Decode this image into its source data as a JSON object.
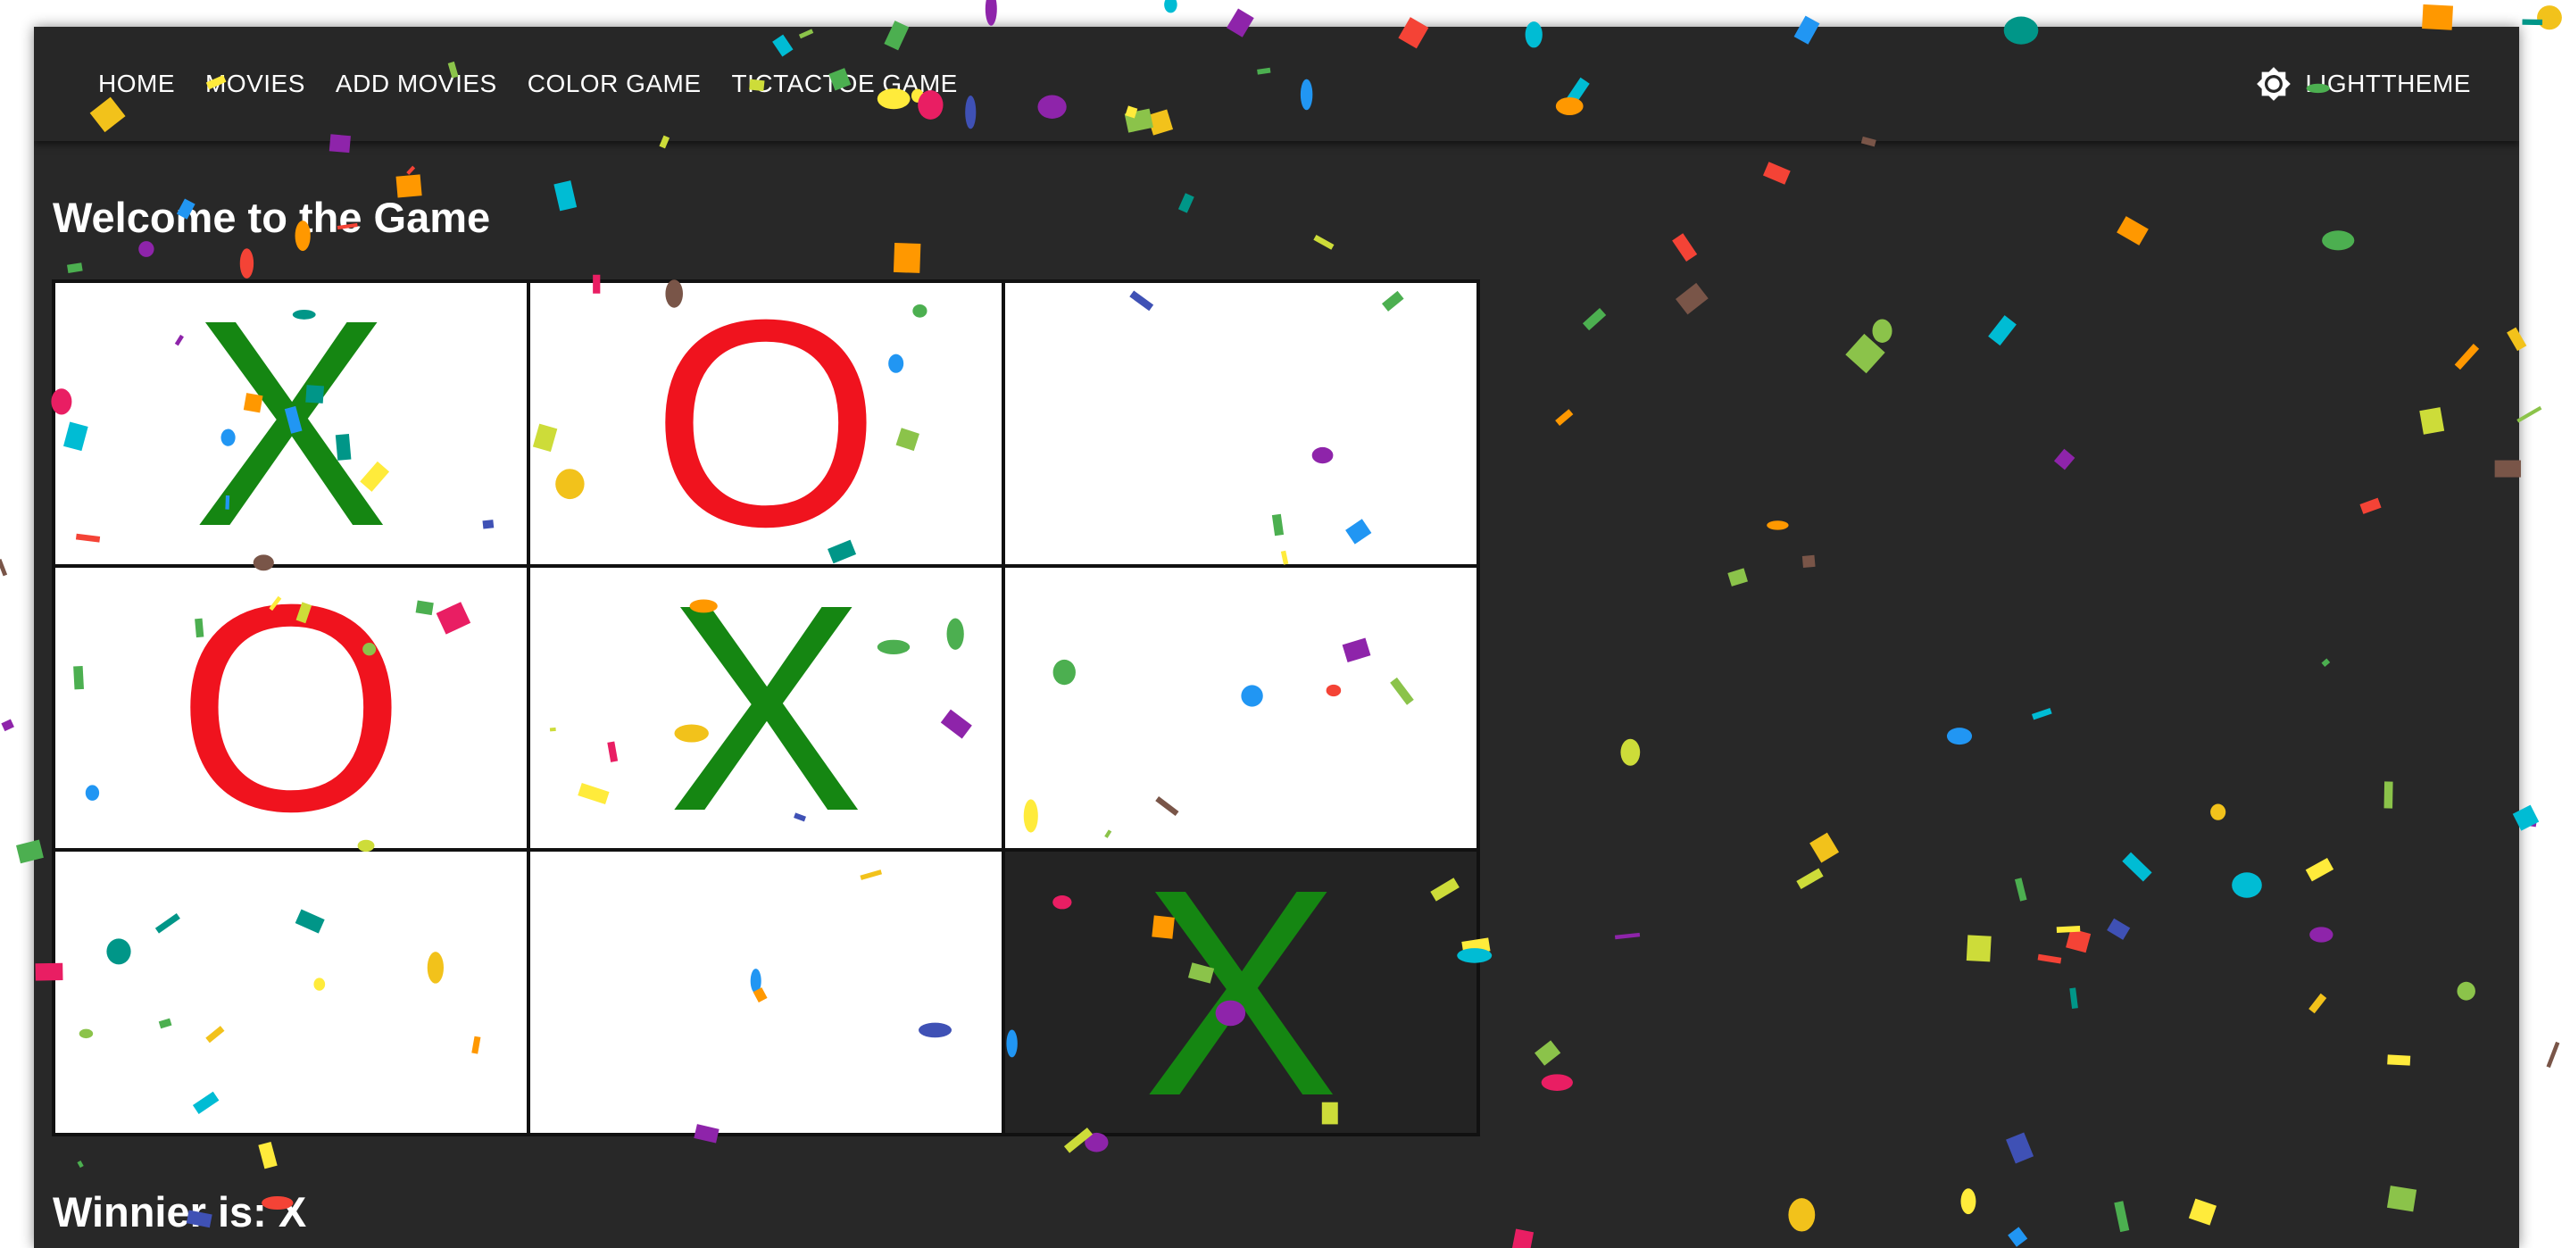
{
  "navbar": {
    "links": [
      "HOME",
      "MOVIES",
      "ADD MOVIES",
      "COLOR GAME",
      "TICTACTOE GAME"
    ],
    "theme_toggle_label": "LIGHTTHEME",
    "theme_icon": "brightness-gear-icon"
  },
  "game": {
    "title": "Welcome to the Game",
    "board": [
      "X",
      "O",
      "",
      "O",
      "X",
      "",
      "",
      "",
      "X"
    ],
    "winner_text": "Winnier is: X"
  },
  "colors": {
    "background": "#282828",
    "navbar": "#272727",
    "x_mark": "#158612",
    "o_mark": "#f0131e",
    "cell": "#ffffff",
    "last_cell": "#232323"
  }
}
